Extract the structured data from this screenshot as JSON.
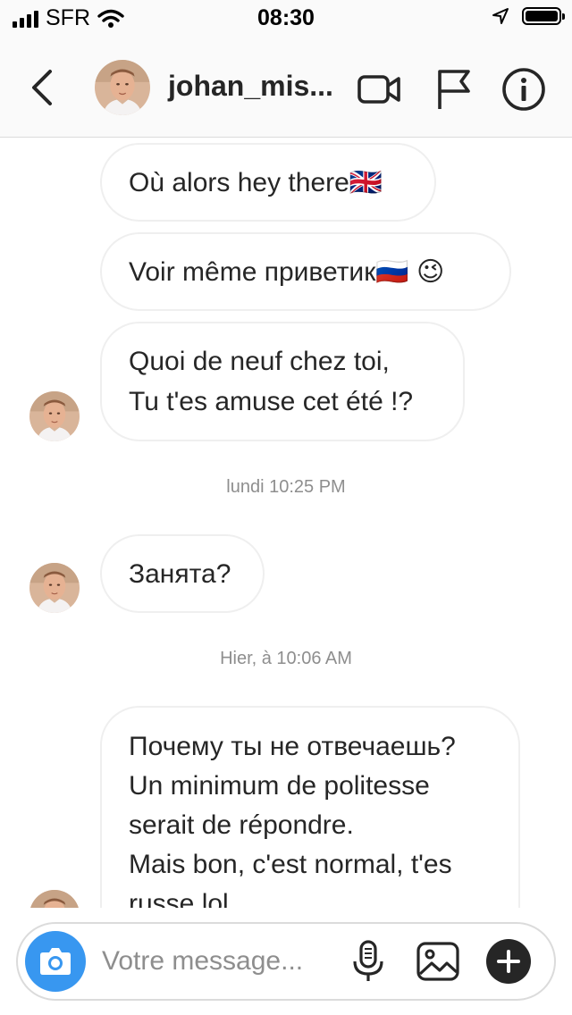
{
  "status_bar": {
    "carrier": "SFR",
    "time": "08:30"
  },
  "header": {
    "username": "johan_mis..."
  },
  "chat": {
    "messages": [
      {
        "lines": [
          "Où alors hey there🇬🇧"
        ]
      },
      {
        "lines": [
          "Voir même приветик🇷🇺 😉"
        ]
      },
      {
        "lines": [
          "Quoi de neuf chez toi,",
          "Tu t'es amuse cet été !?"
        ]
      },
      {
        "lines": [
          "Занята?"
        ]
      },
      {
        "lines": [
          "Почему ты не отвечаешь?",
          "Un minimum de politesse",
          "serait de répondre.",
          "Mais bon, c'est normal, t'es",
          "russe lol"
        ]
      }
    ],
    "timestamps": [
      "lundi 10:25 PM",
      "Hier, à 10:06 AM"
    ]
  },
  "composer": {
    "placeholder": "Votre message..."
  },
  "icons": {
    "back": "chevron-left-icon",
    "video": "video-camera-icon",
    "flag": "flag-icon",
    "info": "info-icon",
    "camera": "camera-icon",
    "mic": "microphone-icon",
    "gallery": "image-icon",
    "plus": "plus-icon"
  },
  "colors": {
    "accent": "#3897f0",
    "bubble_border": "#efefef",
    "text": "#262626",
    "muted": "#8e8e8e"
  }
}
